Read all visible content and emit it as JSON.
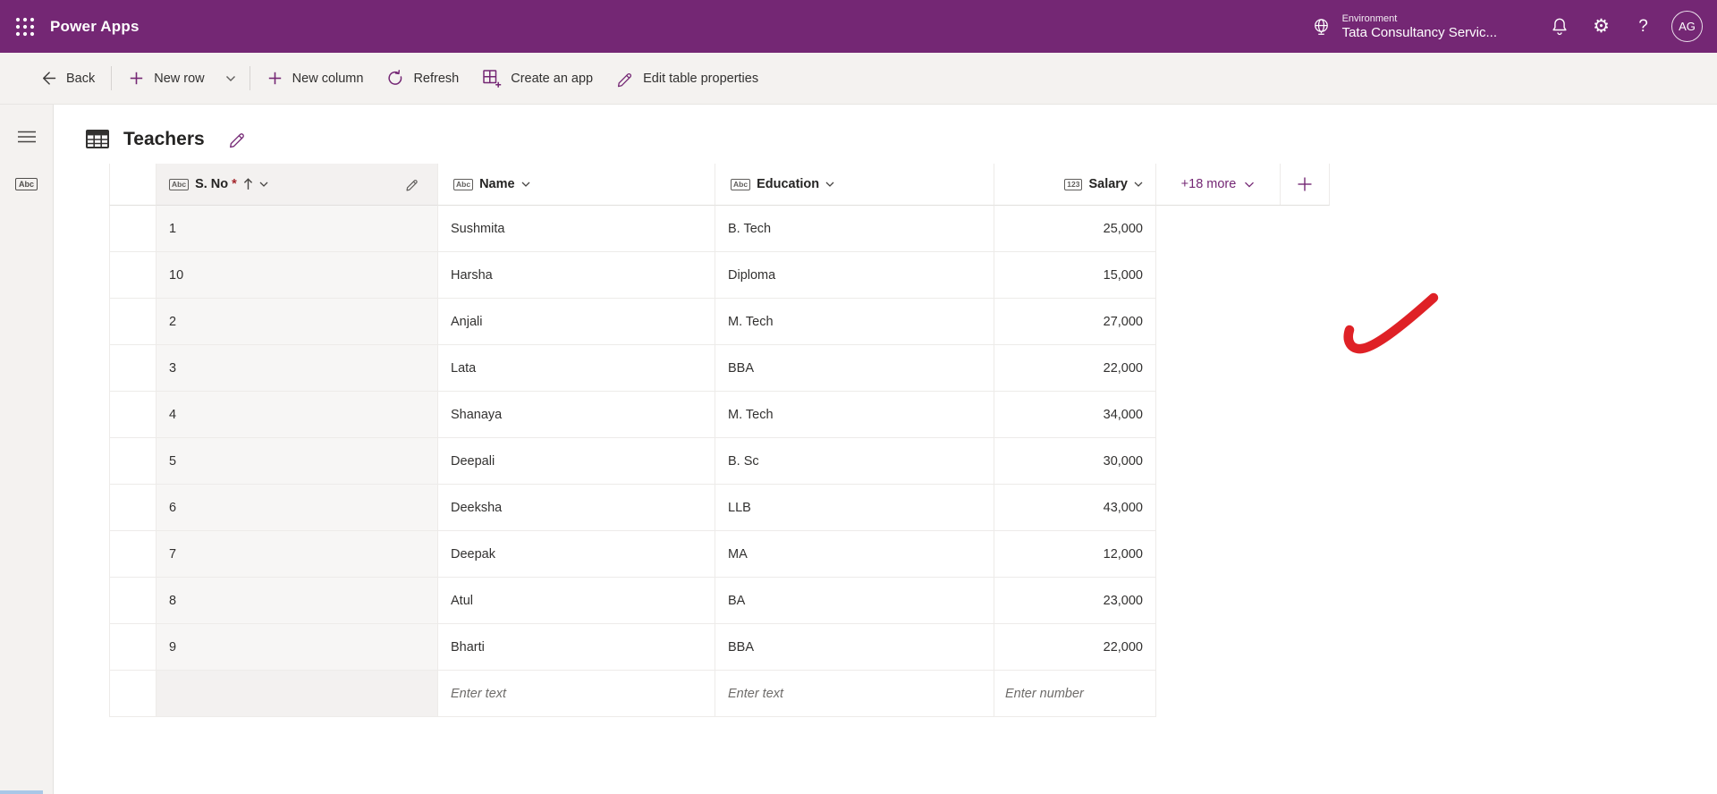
{
  "topbar": {
    "product": "Power Apps",
    "environment_label": "Environment",
    "environment_name": "Tata Consultancy Servic...",
    "avatar_initials": "AG",
    "help_glyph": "?",
    "gear_glyph": "⚙"
  },
  "toolbar": {
    "back": "Back",
    "new_row": "New row",
    "new_column": "New column",
    "refresh": "Refresh",
    "create_an_app": "Create an app",
    "edit_table_properties": "Edit table properties"
  },
  "sidebar": {
    "icons": [
      "hamburger-menu-icon",
      "abc-table-icon"
    ],
    "abc_chip_label": "Abc"
  },
  "view": {
    "title": "Teachers"
  },
  "table_view": {
    "columns": [
      {
        "icon_label": "Abc",
        "label": "S. No",
        "required_marker": "*",
        "sorted": "ascending"
      },
      {
        "icon_label": "Abc",
        "label": "Name"
      },
      {
        "icon_label": "Abc",
        "label": "Education"
      },
      {
        "icon_label": "123",
        "label": "Salary"
      }
    ],
    "more_columns_label": "+18 more",
    "rows": [
      {
        "sno": "1",
        "name": "Sushmita",
        "education": "B. Tech",
        "salary": "25,000"
      },
      {
        "sno": "10",
        "name": "Harsha",
        "education": "Diploma",
        "salary": "15,000"
      },
      {
        "sno": "2",
        "name": "Anjali",
        "education": "M. Tech",
        "salary": "27,000"
      },
      {
        "sno": "3",
        "name": "Lata",
        "education": "BBA",
        "salary": "22,000"
      },
      {
        "sno": "4",
        "name": "Shanaya",
        "education": "M. Tech",
        "salary": "34,000"
      },
      {
        "sno": "5",
        "name": "Deepali",
        "education": "B. Sc",
        "salary": "30,000"
      },
      {
        "sno": "6",
        "name": "Deeksha",
        "education": "LLB",
        "salary": "43,000"
      },
      {
        "sno": "7",
        "name": "Deepak",
        "education": "MA",
        "salary": "12,000"
      },
      {
        "sno": "8",
        "name": "Atul",
        "education": "BA",
        "salary": "23,000"
      },
      {
        "sno": "9",
        "name": "Bharti",
        "education": "BBA",
        "salary": "22,000"
      }
    ],
    "input_row": {
      "name_placeholder": "Enter text",
      "education_placeholder": "Enter text",
      "salary_placeholder": "Enter number"
    }
  },
  "annotation": {
    "shape": "hand-drawn-check-mark",
    "color": "#df2126"
  },
  "colors": {
    "brand_purple": "#742774",
    "toolbar_bg": "#f4f2f0",
    "grid_line": "#edebe9",
    "sorted_column_bg": "#f7f6f5",
    "sorted_header_bg": "#f3f1f0",
    "required_red": "#a4262c"
  }
}
